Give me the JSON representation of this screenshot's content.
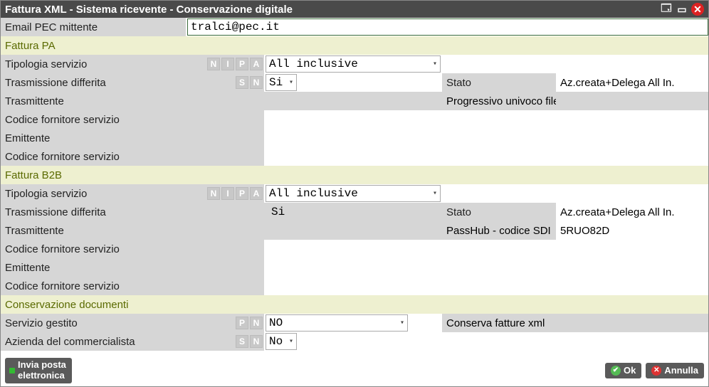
{
  "window": {
    "title": "Fattura XML - Sistema ricevente - Conservazione digitale"
  },
  "email": {
    "label": "Email PEC mittente",
    "value": "tralci@pec.it"
  },
  "sections": {
    "pa": "Fattura PA",
    "b2b": "Fattura B2B",
    "conserv": "Conservazione documenti"
  },
  "pa": {
    "tipologia_label": "Tipologia servizio",
    "tipologia_tags": [
      "N",
      "I",
      "P",
      "A"
    ],
    "tipologia_value": "All inclusive",
    "trasm_diff_label": "Trasmissione differita",
    "trasm_diff_tags": [
      "S",
      "N"
    ],
    "trasm_diff_value": "Si",
    "stato_label": "Stato",
    "stato_value": "Az.creata+Delega All In.",
    "trasmittente_label": "Trasmittente",
    "progr_label": "Progressivo univoco file",
    "cod_forn1": "Codice fornitore servizio",
    "emittente": "Emittente",
    "cod_forn2": "Codice fornitore servizio"
  },
  "b2b": {
    "tipologia_label": "Tipologia servizio",
    "tipologia_tags": [
      "N",
      "I",
      "P",
      "A"
    ],
    "tipologia_value": "All inclusive",
    "trasm_diff_label": "Trasmissione differita",
    "trasm_diff_value": "Si",
    "stato_label": "Stato",
    "stato_value": "Az.creata+Delega All In.",
    "trasmittente_label": "Trasmittente",
    "passhub_label": "PassHub - codice SDI",
    "passhub_value": "5RUO82D",
    "cod_forn1": "Codice fornitore servizio",
    "emittente": "Emittente",
    "cod_forn2": "Codice fornitore servizio"
  },
  "conserv": {
    "servizio_label": "Servizio gestito",
    "servizio_tags": [
      "P",
      "N"
    ],
    "servizio_value": "NO",
    "conserva_label": "Conserva fatture xml",
    "azienda_label": "Azienda del commercialista",
    "azienda_tags": [
      "S",
      "N"
    ],
    "azienda_value": "No"
  },
  "footer": {
    "mail_line1": "Invia posta",
    "mail_line2": "elettronica",
    "ok": "Ok",
    "cancel": "Annulla"
  }
}
